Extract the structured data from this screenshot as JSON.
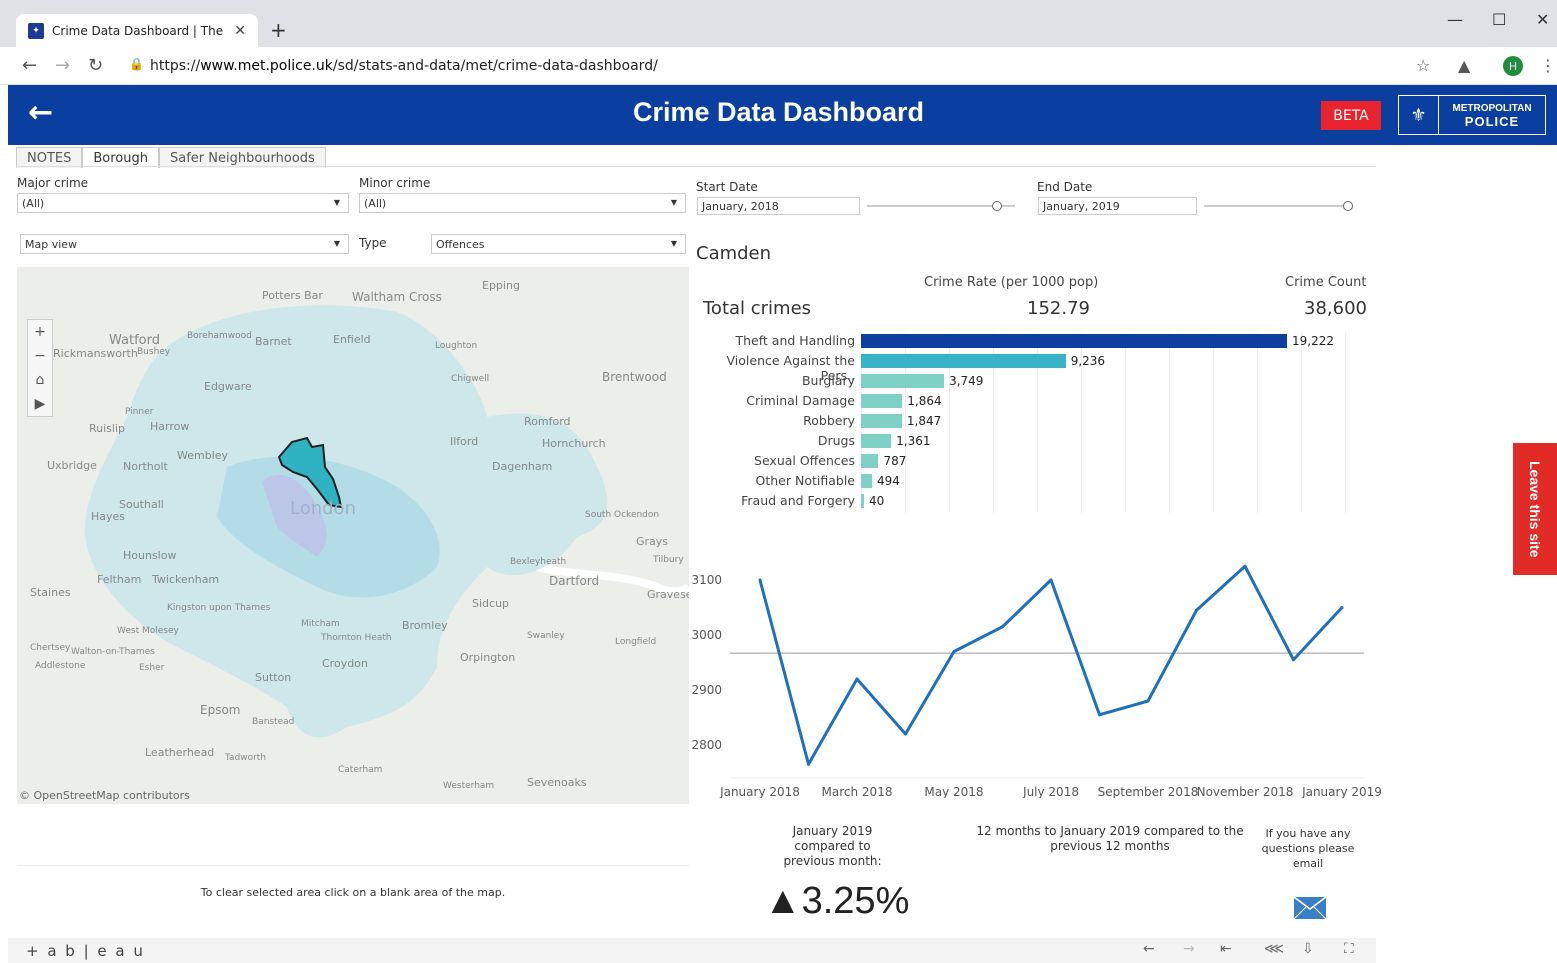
{
  "browser": {
    "tab_title": "Crime Data Dashboard | The Met",
    "url_prefix": "https://",
    "url_domain": "www.met.police.uk",
    "url_path": "/sd/stats-and-data/met/crime-data-dashboard/",
    "profile_initial": "H"
  },
  "banner": {
    "title": "Crime Data Dashboard",
    "beta_label": "BETA",
    "logo_line1": "METROPOLITAN",
    "logo_line2": "POLICE"
  },
  "tabs": [
    {
      "label": "NOTES"
    },
    {
      "label": "Borough"
    },
    {
      "label": "Safer Neighbourhoods"
    }
  ],
  "filters": {
    "major_crime_label": "Major crime",
    "major_crime_value": "(All)",
    "minor_crime_label": "Minor crime",
    "minor_crime_value": "(All)",
    "view_value": "Map view",
    "type_label": "Type",
    "type_value": "Offences",
    "start_date_label": "Start Date",
    "start_date_value": "January, 2018",
    "end_date_label": "End Date",
    "end_date_value": "January, 2019"
  },
  "map": {
    "attribution": "© OpenStreetMap contributors",
    "clear_note": "To clear selected area click on a blank area of the map.",
    "places": [
      "Potters Bar",
      "Waltham Cross",
      "Epping",
      "Watford",
      "Borehamwood",
      "Loughton",
      "Rickmansworth",
      "Bushey",
      "Chigwell",
      "Brentwood",
      "Romford",
      "Hornchurch",
      "Uxbridge",
      "Northolt",
      "Wembley",
      "Dagenham",
      "Southall",
      "London",
      "Hayes",
      "Hounslow",
      "South Ockendon",
      "Grays",
      "Tilbury",
      "Staines",
      "Feltham",
      "Twickenham",
      "Dartford",
      "Gravesend",
      "West Molesey",
      "Chertsey",
      "Walton-on-Thames",
      "Addlestone",
      "Esher",
      "Croydon",
      "Orpington",
      "Swanley",
      "Longfield",
      "Epsom",
      "Banstead",
      "Leatherhead",
      "Tadworth",
      "Caterham",
      "Westerham",
      "Sevenoaks",
      "Bromley",
      "Thornton Heath",
      "Mitcham",
      "Sutton",
      "Kingston upon Thames",
      "Ilford",
      "Sidcup",
      "Bexleyheath",
      "Ruislip",
      "Harrow",
      "Enfield",
      "Barnet",
      "Edgware",
      "Pinner"
    ]
  },
  "summary": {
    "borough": "Camden",
    "rate_header": "Crime Rate (per 1000 pop)",
    "count_header": "Crime Count",
    "total_label": "Total crimes",
    "total_rate": "152.79",
    "total_count": "38,600"
  },
  "bars_chart": {
    "type": "bar",
    "categories": [
      "Theft and Handling",
      "Violence Against the Pers..",
      "Burglary",
      "Criminal Damage",
      "Robbery",
      "Drugs",
      "Sexual Offences",
      "Other Notifiable",
      "Fraud and Forgery"
    ],
    "values": [
      19222,
      9236,
      3749,
      1864,
      1847,
      1361,
      787,
      494,
      40
    ],
    "value_labels": [
      "19,222",
      "9,236",
      "3,749",
      "1,864",
      "1,847",
      "1,361",
      "787",
      "494",
      "40"
    ],
    "colors": [
      "#0d3fa0",
      "#38b2c7",
      "#7fd1c6",
      "#7fd1c6",
      "#7fd1c6",
      "#7fd1c6",
      "#7fd1c6",
      "#7fd1c6",
      "#7fd1c6"
    ]
  },
  "chart_data": {
    "type": "line",
    "x": [
      "January 2018",
      "February 2018",
      "March 2018",
      "April 2018",
      "May 2018",
      "June 2018",
      "July 2018",
      "August 2018",
      "September 2018",
      "October 2018",
      "November 2018",
      "December 2018",
      "January 2019"
    ],
    "series": [
      {
        "values": [
          3100,
          2765,
          2920,
          2820,
          2970,
          3015,
          3100,
          2855,
          2880,
          3045,
          3125,
          2955,
          3050
        ]
      }
    ],
    "xtick_labels": [
      "January 2018",
      "March 2018",
      "May 2018",
      "July 2018",
      "September 2018",
      "November 2018",
      "January 2019"
    ],
    "ytick_labels": [
      "2800",
      "2900",
      "3000",
      "3100"
    ],
    "ylim": [
      2740,
      3140
    ],
    "reference_line": 2967,
    "color": "#1f6fbf"
  },
  "stats": {
    "month_compare": "January 2019 compared to previous month:",
    "year_compare": "12 months to January 2019 compared to the previous 12 months",
    "questions": "If you have any questions please email",
    "month_change": "▲3.25%"
  },
  "leave_site": "Leave this site",
  "tableau_logo": "+ a b | e a u"
}
